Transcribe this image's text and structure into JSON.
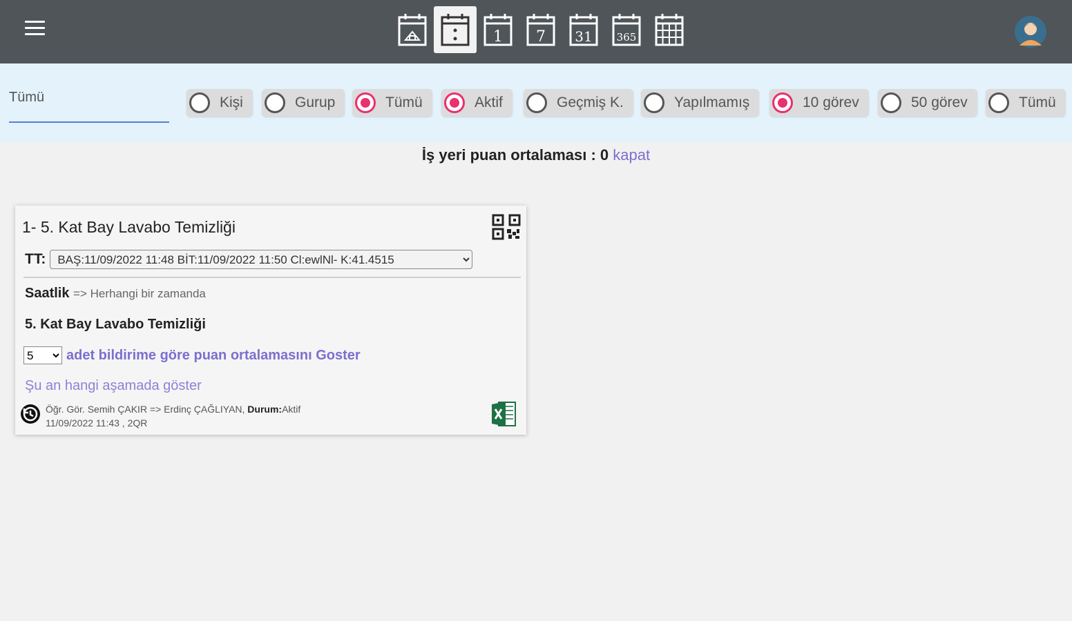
{
  "topbar": {
    "menu_icon": "hamburger-icon",
    "calendar_buttons": [
      {
        "icon": "calendar-home-icon",
        "active": false
      },
      {
        "icon": "calendar-dots-icon",
        "active": true
      },
      {
        "icon": "calendar-day-icon",
        "label": "1",
        "active": false
      },
      {
        "icon": "calendar-week-icon",
        "label": "7",
        "active": false
      },
      {
        "icon": "calendar-month-icon",
        "label": "31",
        "active": false
      },
      {
        "icon": "calendar-year-icon",
        "label": "365",
        "active": false
      },
      {
        "icon": "calendar-grid-icon",
        "active": false
      }
    ],
    "avatar_icon": "user-avatar-icon"
  },
  "filters": {
    "search_value": "Tümü",
    "radios": [
      {
        "label": "Kişi",
        "checked": false
      },
      {
        "label": "Gurup",
        "checked": false
      },
      {
        "label": "Tümü",
        "checked": true
      },
      {
        "label": "Aktif",
        "checked": true
      },
      {
        "label": "Geçmiş K.",
        "checked": false
      },
      {
        "label": "Yapılmamış",
        "checked": false
      },
      {
        "label": "10 görev",
        "checked": true
      },
      {
        "label": "50 görev",
        "checked": false
      },
      {
        "label": "Tümü",
        "checked": false
      }
    ],
    "accent_color": "#e8316f"
  },
  "score": {
    "label": "İş yeri puan ortalaması : 0",
    "close_link": "kapat"
  },
  "card": {
    "title": "1- 5. Kat Bay Lavabo Temizliği",
    "tt_label": "TT:",
    "tt_selected": "BAŞ:11/09/2022 11:48 BİT:11/09/2022 11:50 Cl:ewlNl- K:41.4515",
    "type_label": "Saatlik",
    "type_desc": "=> Herhangi bir zamanda",
    "task_name": "5. Kat Bay Lavabo Temizliği",
    "avg_count": "5",
    "avg_link": "adet bildirime göre puan ortalamasını Goster",
    "stage_link": "Şu an hangi aşamada göster",
    "meta_people": "Öğr. Gör. Semih ÇAKIR => Erdinç ÇAĞLIYAN,",
    "meta_status_label": "Durum:",
    "meta_status_value": "Aktif",
    "meta_time": "11/09/2022 11:43 , 2QR",
    "icons": {
      "qr": "qr-code-icon",
      "history": "history-icon",
      "excel": "excel-icon"
    }
  }
}
